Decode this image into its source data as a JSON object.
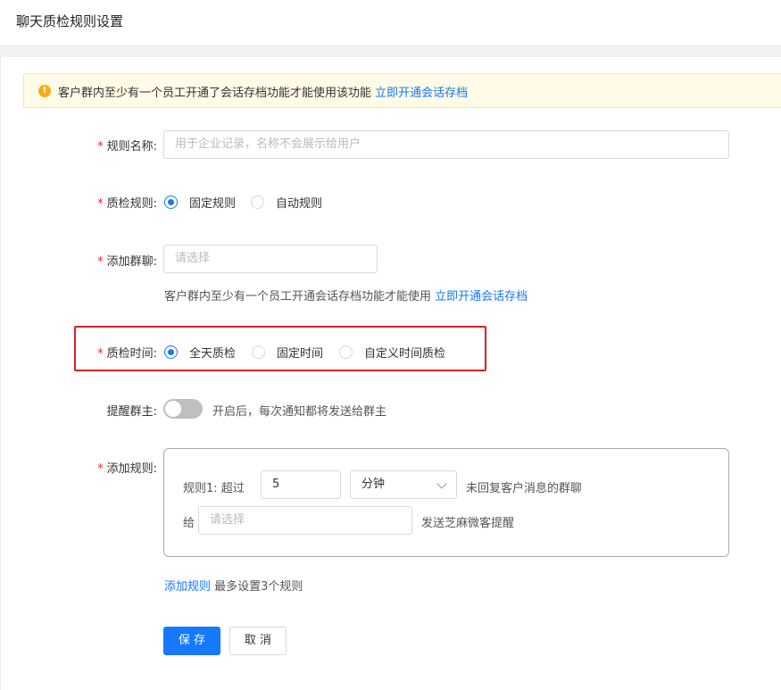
{
  "page": {
    "title": "聊天质检规则设置"
  },
  "notice": {
    "text": "客户群内至少有一个员工开通了会话存档功能才能使用该功能",
    "link": "立即开通会话存档",
    "icon": "warning-icon"
  },
  "form": {
    "rule_name": {
      "label": "规则名称:",
      "placeholder": "用于企业记录，名称不会展示给用户"
    },
    "rule_type": {
      "label": "质检规则:",
      "options": [
        "固定规则",
        "自动规则"
      ],
      "selected": "固定规则"
    },
    "group_chat": {
      "label": "添加群聊:",
      "placeholder": "请选择",
      "hint": "客户群内至少有一个员工开通会话存档功能才能使用",
      "hint_link": "立即开通会话存档"
    },
    "check_time": {
      "label": "质检时间:",
      "options": [
        "全天质检",
        "固定时间",
        "自定义时间质检"
      ],
      "selected": "全天质检"
    },
    "remind_owner": {
      "label": "提醒群主:",
      "enabled": false,
      "hint": "开启后，每次通知都将发送给群主"
    },
    "rules": {
      "label": "添加规则:",
      "rule1": {
        "prefix": "规则1:  超过",
        "value": "5",
        "unit": "分钟",
        "suffix": "未回复客户消息的群聊",
        "to_label": "给",
        "to_placeholder": "请选择",
        "action": "发送芝麻微客提醒"
      },
      "add_link": "添加规则",
      "add_hint": "最多设置3个规则"
    }
  },
  "buttons": {
    "save": "保 存",
    "cancel": "取 消"
  },
  "colors": {
    "primary": "#1677ff",
    "required": "#f5222d",
    "highlight_box": "#e02020",
    "notice_bg": "#fffbe6"
  }
}
